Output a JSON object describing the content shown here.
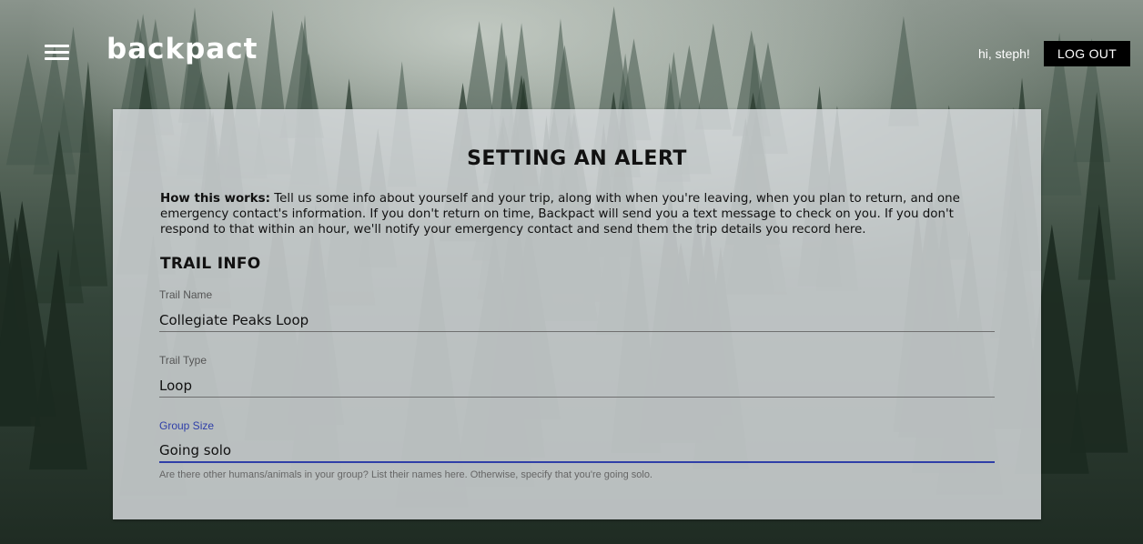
{
  "header": {
    "brand": "backpact",
    "greeting": "hi, steph!",
    "logout_label": "LOG OUT",
    "menu_icon": "hamburger-menu-icon"
  },
  "card": {
    "title": "SETTING AN ALERT",
    "intro_lead": "How this works:",
    "intro_text": " Tell us some info about yourself and your trip, along with when you're leaving, when you plan to return, and one emergency contact's information. If you don't return on time, Backpact will send you a text message to check on you. If you don't respond to that within an hour, we'll notify your emergency contact and send them the trip details you record here.",
    "section_title": "TRAIL INFO",
    "fields": [
      {
        "label": "Trail Name",
        "value": "Collegiate Peaks Loop"
      },
      {
        "label": "Trail Type",
        "value": "Loop"
      },
      {
        "label": "Group Size",
        "value": "Going solo",
        "focused": true,
        "helper": "Are there other humans/animals in your group? List their names here. Otherwise, specify that you're going solo."
      }
    ]
  },
  "colors": {
    "accent": "#2f3fa8",
    "logout_bg": "#000000",
    "card_bg": "#d6dadc"
  }
}
